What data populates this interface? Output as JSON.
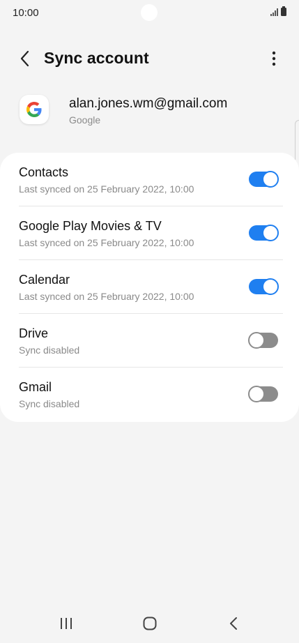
{
  "status_bar": {
    "time": "10:00"
  },
  "header": {
    "title": "Sync account",
    "back_icon": "chevron-left-icon",
    "more_icon": "more-vertical-icon"
  },
  "account": {
    "email": "alan.jones.wm@gmail.com",
    "type": "Google",
    "logo_icon": "google-logo"
  },
  "colors": {
    "accent": "#1f7ff0",
    "toggle_off": "#8c8c8c",
    "background": "#f4f4f4",
    "card": "#ffffff"
  },
  "sync_items": [
    {
      "title": "Contacts",
      "subtitle": "Last synced on 25 February 2022, 10:00",
      "enabled": true
    },
    {
      "title": "Google Play Movies & TV",
      "subtitle": "Last synced on 25 February 2022, 10:00",
      "enabled": true
    },
    {
      "title": "Calendar",
      "subtitle": "Last synced on 25 February 2022, 10:00",
      "enabled": true
    },
    {
      "title": "Drive",
      "subtitle": "Sync disabled",
      "enabled": false
    },
    {
      "title": "Gmail",
      "subtitle": "Sync disabled",
      "enabled": false
    }
  ],
  "nav_bar": {
    "recents_icon": "recent-apps-icon",
    "home_icon": "home-icon",
    "back_icon": "back-icon"
  }
}
